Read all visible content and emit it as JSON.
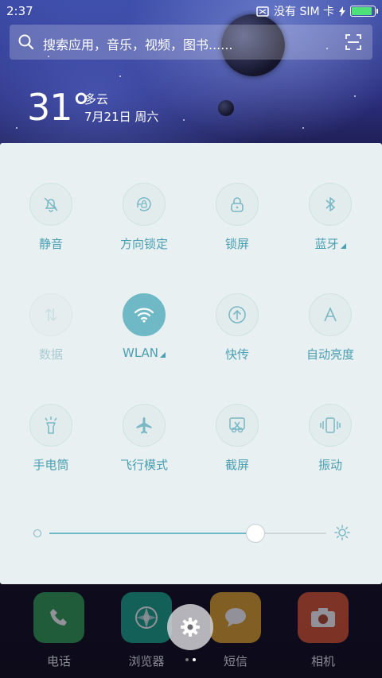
{
  "status_bar": {
    "time": "2:37",
    "carrier": "没有 SIM 卡",
    "battery_level": 1.0,
    "battery_color": "#4ee07a"
  },
  "search": {
    "placeholder": "搜索应用，音乐，视频，图书......",
    "icon": "search-icon",
    "scan_icon": "scan-icon"
  },
  "weather": {
    "temperature": "31°",
    "condition": "多云",
    "date": "7月21日 周六"
  },
  "quick_settings": {
    "tiles": [
      {
        "id": "mute",
        "label": "静音",
        "icon": "bell-off-icon",
        "state": "off"
      },
      {
        "id": "rotation-lock",
        "label": "方向锁定",
        "icon": "rotation-lock-icon",
        "state": "off"
      },
      {
        "id": "lock-screen",
        "label": "锁屏",
        "icon": "lock-icon",
        "state": "off"
      },
      {
        "id": "bluetooth",
        "label": "蓝牙",
        "icon": "bluetooth-icon",
        "state": "off",
        "has_more": true
      },
      {
        "id": "data",
        "label": "数据",
        "icon": "data-arrows-icon",
        "state": "disabled"
      },
      {
        "id": "wlan",
        "label": "WLAN",
        "icon": "wifi-icon",
        "state": "on",
        "has_more": true
      },
      {
        "id": "quick-transfer",
        "label": "快传",
        "icon": "upload-circle-icon",
        "state": "off"
      },
      {
        "id": "auto-brightness",
        "label": "自动亮度",
        "icon": "letter-a-icon",
        "state": "off"
      },
      {
        "id": "flashlight",
        "label": "手电筒",
        "icon": "flashlight-icon",
        "state": "off"
      },
      {
        "id": "airplane",
        "label": "飞行模式",
        "icon": "airplane-icon",
        "state": "off"
      },
      {
        "id": "screenshot",
        "label": "截屏",
        "icon": "scissors-icon",
        "state": "off"
      },
      {
        "id": "vibrate",
        "label": "振动",
        "icon": "vibrate-icon",
        "state": "off"
      }
    ],
    "brightness": 0.74,
    "accent_color": "#6fb9c7"
  },
  "dock": {
    "apps": [
      {
        "label": "电话",
        "icon": "phone-icon",
        "color": "#2f9f52"
      },
      {
        "label": "浏览器",
        "icon": "browser-icon",
        "color": "#16a58a"
      },
      {
        "label": "短信",
        "icon": "message-icon",
        "color": "#e0a32a"
      },
      {
        "label": "相机",
        "icon": "camera-icon",
        "color": "#d8542f"
      }
    ],
    "settings_icon": "gear-icon",
    "page_count": 2,
    "current_page": 2
  }
}
